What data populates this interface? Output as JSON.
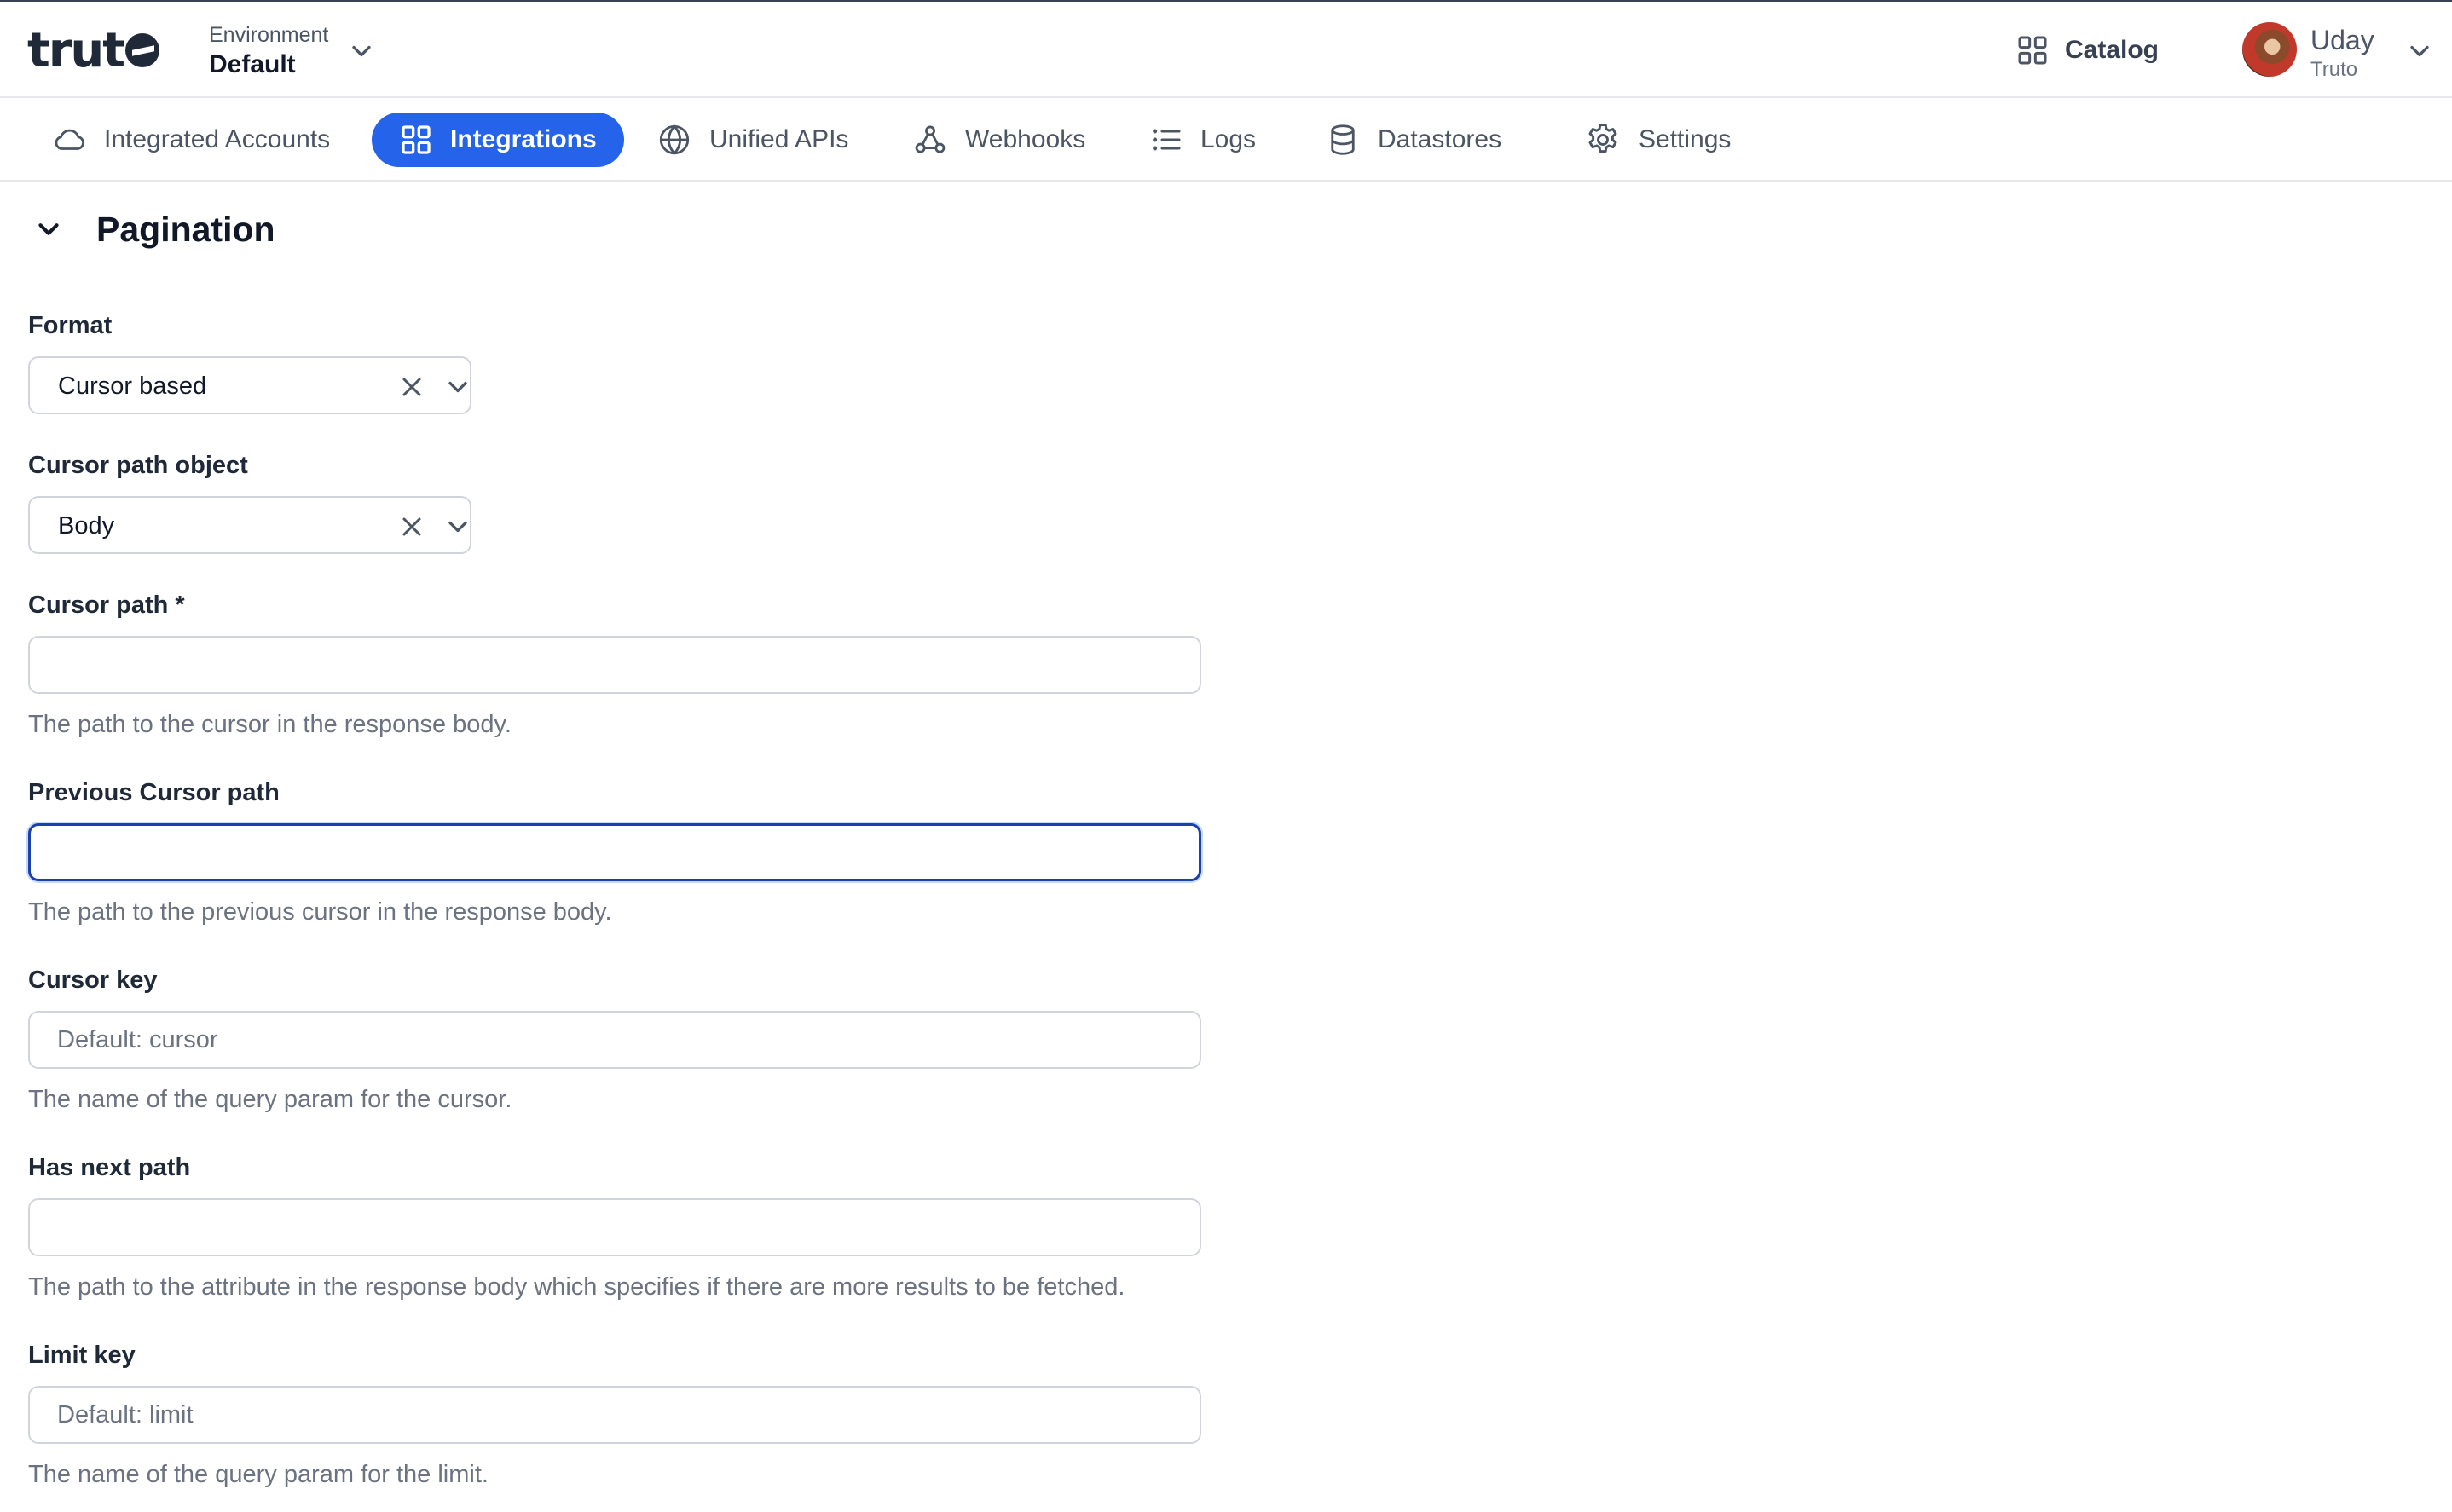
{
  "app": {
    "logo_text": "truto"
  },
  "header": {
    "environment_label": "Environment",
    "environment_value": "Default",
    "catalog_label": "Catalog",
    "user_name": "Uday",
    "user_org": "Truto"
  },
  "nav": {
    "tabs": [
      {
        "label": "Integrated Accounts",
        "icon": "cloud-icon",
        "active": false
      },
      {
        "label": "Integrations",
        "icon": "grid-icon",
        "active": true
      },
      {
        "label": "Unified APIs",
        "icon": "globe-icon",
        "active": false
      },
      {
        "label": "Webhooks",
        "icon": "webhook-icon",
        "active": false
      },
      {
        "label": "Logs",
        "icon": "list-icon",
        "active": false
      },
      {
        "label": "Datastores",
        "icon": "database-icon",
        "active": false
      },
      {
        "label": "Settings",
        "icon": "gear-icon",
        "active": false
      }
    ]
  },
  "section": {
    "title": "Pagination"
  },
  "form": {
    "format": {
      "label": "Format",
      "value": "Cursor based"
    },
    "cursor_path_object": {
      "label": "Cursor path object",
      "value": "Body"
    },
    "cursor_path": {
      "label": "Cursor path *",
      "value": "",
      "placeholder": "",
      "help": "The path to the cursor in the response body."
    },
    "previous_cursor_path": {
      "label": "Previous Cursor path",
      "value": "",
      "placeholder": "",
      "help": "The path to the previous cursor in the response body."
    },
    "cursor_key": {
      "label": "Cursor key",
      "value": "",
      "placeholder": "Default: cursor",
      "help": "The name of the query param for the cursor."
    },
    "has_next_path": {
      "label": "Has next path",
      "value": "",
      "placeholder": "",
      "help": "The path to the attribute in the response body which specifies if there are more results to be fetched."
    },
    "limit_key": {
      "label": "Limit key",
      "value": "",
      "placeholder": "Default: limit",
      "help": "The name of the query param for the limit."
    }
  },
  "colors": {
    "accent": "#2563eb",
    "focus_border": "#1e40af",
    "text": "#1f2937",
    "muted": "#6b7280"
  }
}
